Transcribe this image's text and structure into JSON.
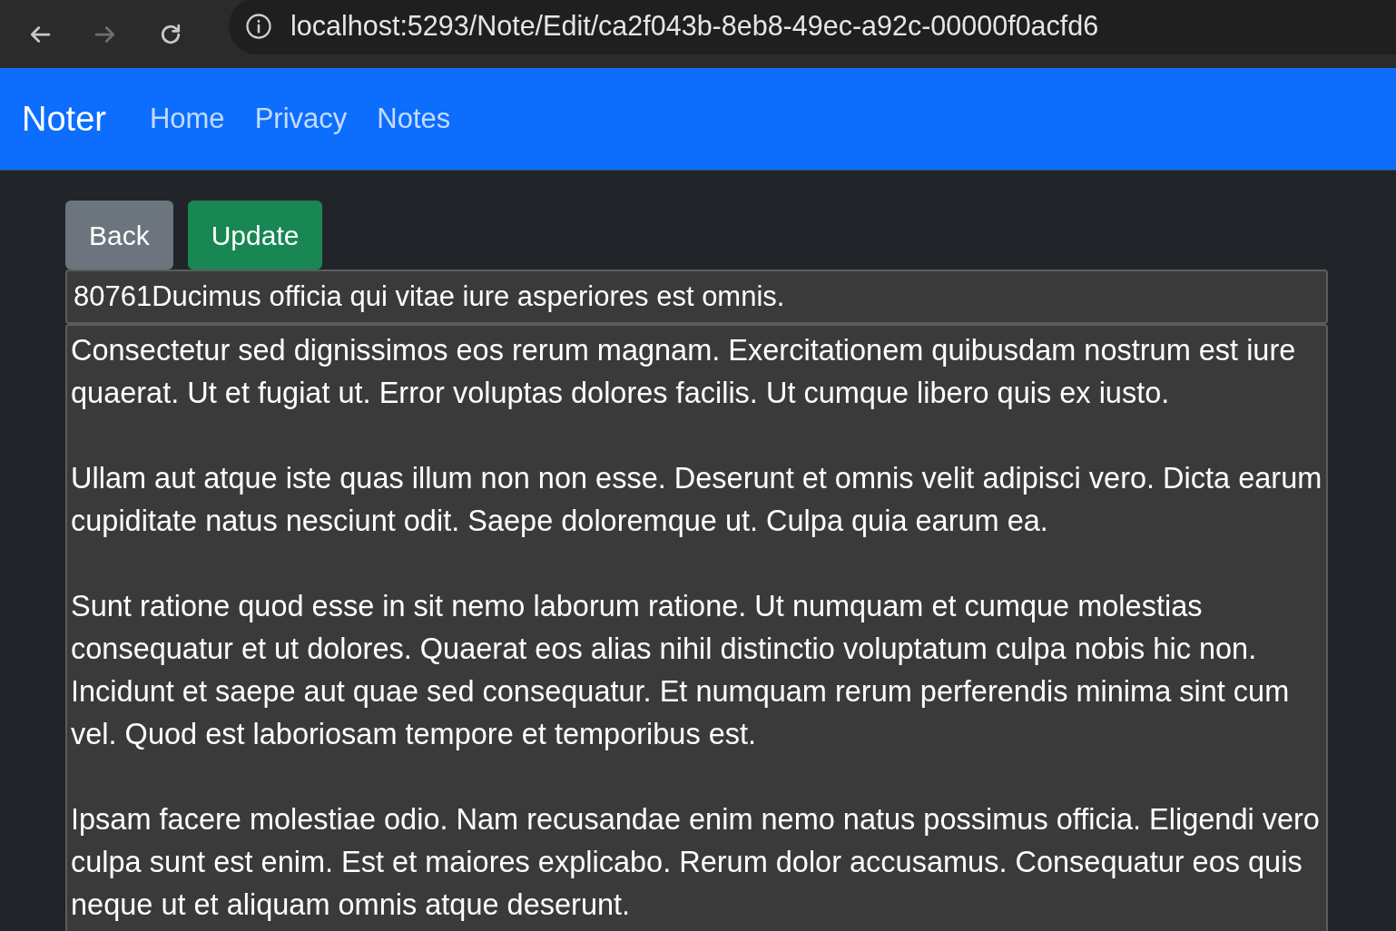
{
  "browser": {
    "buttons": [
      {
        "kind": "back",
        "disabled": false
      },
      {
        "kind": "forward",
        "disabled": true
      },
      {
        "kind": "reload",
        "disabled": false
      }
    ],
    "url": "localhost:5293/Note/Edit/ca2f043b-8eb8-49ec-a92c-00000f0acfd6"
  },
  "navbar": {
    "brand": "Noter",
    "links": [
      "Home",
      "Privacy",
      "Notes"
    ]
  },
  "buttons": [
    {
      "kind": "secondary",
      "label": "Back"
    },
    {
      "kind": "success",
      "label": "Update"
    }
  ],
  "title_field": {
    "value": "80761Ducimus officia qui vitae iure asperiores est omnis."
  },
  "body_field": {
    "value": "Consectetur sed dignissimos eos rerum magnam. Exercitationem quibusdam nostrum est iure quaerat. Ut et fugiat ut. Error voluptas dolores facilis. Ut cumque libero quis ex iusto.\n\nUllam aut atque iste quas illum non non esse. Deserunt et omnis velit adipisci vero. Dicta earum cupiditate natus nesciunt odit. Saepe doloremque ut. Culpa quia earum ea.\n\nSunt ratione quod esse in sit nemo laborum ratione. Ut numquam et cumque molestias consequatur et ut dolores. Quaerat eos alias nihil distinctio voluptatum culpa nobis hic non. Incidunt et saepe aut quae sed consequatur. Et numquam rerum perferendis minima sint cum vel. Quod est laboriosam tempore et temporibus est.\n\nIpsam facere molestiae odio. Nam recusandae enim nemo natus possimus officia. Eligendi vero culpa sunt est enim. Est et maiores explicabo. Rerum dolor accusamus. Consequatur eos quis neque ut et aliquam omnis atque deserunt."
  }
}
